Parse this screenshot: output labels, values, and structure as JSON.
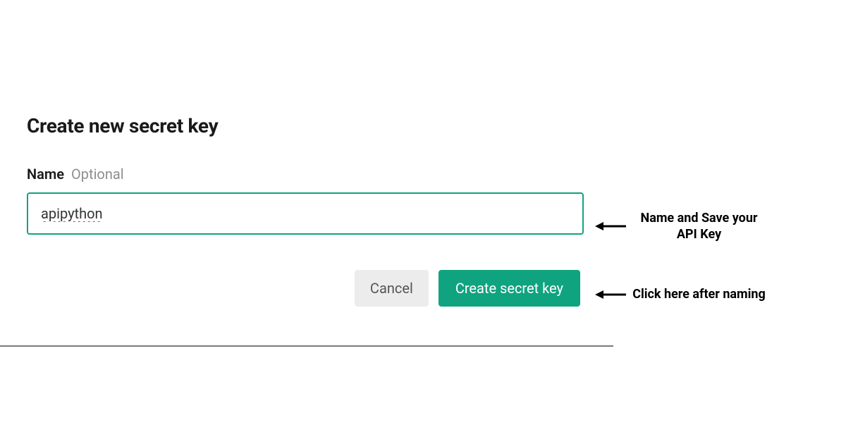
{
  "dialog": {
    "title": "Create new secret key",
    "name_label": "Name",
    "name_hint": "Optional",
    "name_value": "apipython",
    "cancel_label": "Cancel",
    "create_label": "Create secret key"
  },
  "annotations": {
    "input_note": "Name and Save your API Key",
    "button_note": "Click here after naming"
  },
  "colors": {
    "accent": "#10a37f"
  }
}
